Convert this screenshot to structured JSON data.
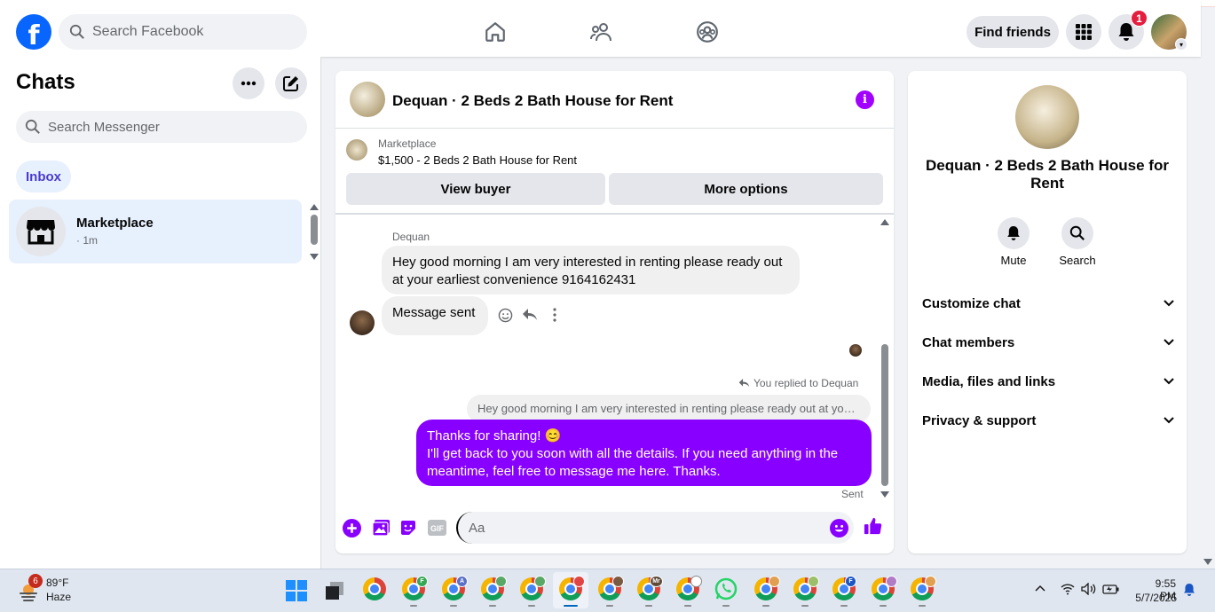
{
  "header": {
    "logo_letter": "f",
    "search_placeholder": "Search Facebook",
    "find_friends_label": "Find friends",
    "notification_count": "1"
  },
  "sidebar": {
    "title": "Chats",
    "search_placeholder": "Search Messenger",
    "filter_label": "Inbox",
    "chats": [
      {
        "name": "Marketplace",
        "time": "· 1m"
      }
    ]
  },
  "conversation": {
    "title": "Dequan · 2 Beds 2 Bath House for Rent",
    "info_icon_glyph": "i",
    "marketplace_label": "Marketplace",
    "listing": "$1,500 - 2 Beds 2 Bath House for Rent",
    "view_buyer_label": "View buyer",
    "more_options_label": "More options",
    "sender_name": "Dequan",
    "incoming_message": "Hey good morning I am very interested in renting please ready out at your earliest convenience 9164162431",
    "incoming_message_2": "Message sent",
    "replied_label": "You replied to Dequan",
    "quoted_text": "Hey good morning I am very interested in renting please ready out at your earliest convenience 9164162431",
    "outgoing_line1": "Thanks for sharing! 😊",
    "outgoing_line2": "I'll get back to you soon with all the details. If you need anything in the meantime, feel free to message me here. Thanks.",
    "status": "Sent",
    "composer_placeholder": "Aa",
    "gif_label": "GIF"
  },
  "details_panel": {
    "title": "Dequan · 2 Beds 2 Bath House for Rent",
    "actions": [
      {
        "label": "Mute",
        "icon": "bell-icon"
      },
      {
        "label": "Search",
        "icon": "search-icon"
      }
    ],
    "sections": [
      "Customize chat",
      "Chat members",
      "Media, files and links",
      "Privacy & support"
    ]
  },
  "taskbar": {
    "weather_badge": "6",
    "temperature": "89°F",
    "condition": "Haze",
    "time": "9:55 PM",
    "date": "5/7/2025",
    "profile_badges": [
      "F",
      "A",
      "",
      "",
      "",
      "",
      "Mr",
      "",
      "",
      "",
      "",
      "F",
      "",
      ""
    ]
  },
  "colors": {
    "accent": "#8800ff",
    "facebook_blue": "#0866ff",
    "notification_red": "#e41e3f"
  }
}
